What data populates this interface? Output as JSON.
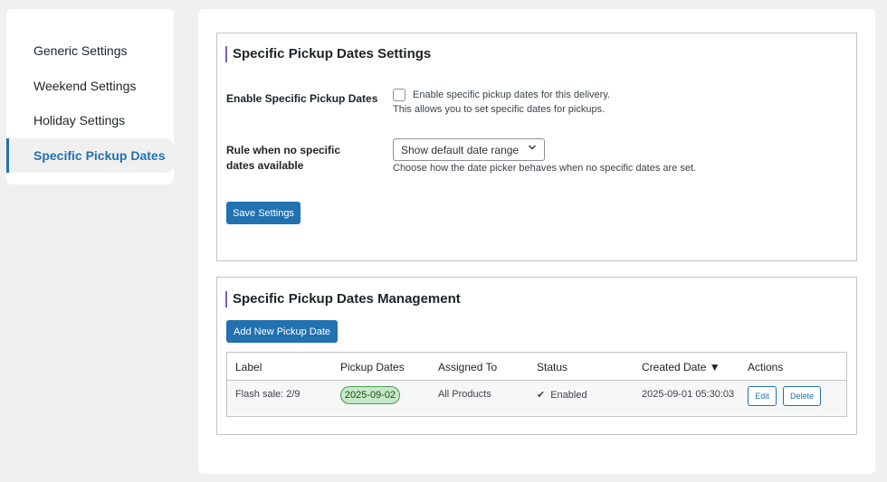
{
  "sidebar": {
    "items": [
      {
        "label": "Generic Settings"
      },
      {
        "label": "Weekend Settings"
      },
      {
        "label": "Holiday Settings"
      },
      {
        "label": "Specific Pickup Dates",
        "active": true
      }
    ]
  },
  "settings_panel": {
    "title": "Specific Pickup Dates Settings",
    "enable_label": "Enable Specific Pickup Dates",
    "enable_checkbox_text": "Enable specific pickup dates for this delivery.",
    "enable_checked": false,
    "enable_desc": "This allows you to set specific dates for pickups.",
    "rule_label": "Rule when no specific dates available",
    "rule_selected": "Show default date range",
    "rule_desc": "Choose how the date picker behaves when no specific dates are set.",
    "save_label": "Save Settings"
  },
  "management_panel": {
    "title": "Specific Pickup Dates Management",
    "add_label": "Add New Pickup Date",
    "columns": [
      "Label",
      "Pickup Dates",
      "Assigned To",
      "Status",
      "Created Date ▼",
      "Actions"
    ],
    "rows": [
      {
        "label": "Flash sale: 2/9",
        "pickup_date": "2025-09-02",
        "assigned_to": "All Products",
        "status_icon": "✔",
        "status": "Enabled",
        "created": "2025-09-01 05:30:03",
        "edit_label": "Edit",
        "delete_label": "Delete"
      }
    ]
  },
  "colors": {
    "accent": "#2271b1",
    "title_bar": "#7e5bbd",
    "pill_bg": "#c6e9c7",
    "pill_border": "#4f9a52"
  }
}
